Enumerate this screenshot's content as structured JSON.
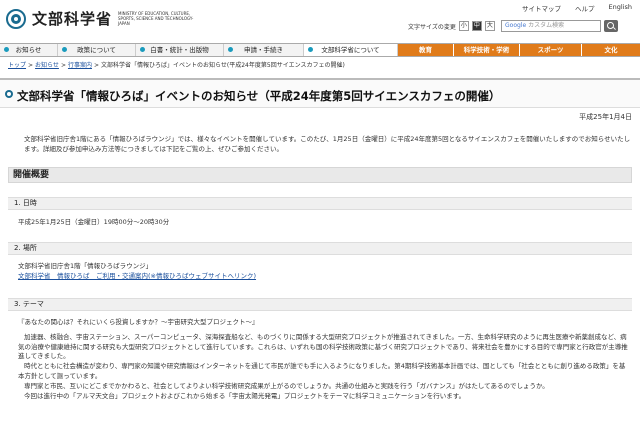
{
  "header": {
    "logo_text": "文部科学省",
    "logo_en": "MINISTRY OF EDUCATION, CULTURE, SPORTS, SCIENCE AND TECHNOLOGY-JAPAN",
    "top_links": [
      "サイトマップ",
      "ヘルプ",
      "English"
    ],
    "fontsize_label": "文字サイズの変更",
    "fontsize_buttons": [
      "小",
      "中",
      "大"
    ],
    "search_brand": "Google",
    "search_placeholder": "カスタム検索"
  },
  "nav": {
    "items": [
      "お知らせ",
      "政策について",
      "白書・統計・出版物",
      "申請・手続き",
      "文部科学省について",
      "教育",
      "科学技術・学術",
      "スポーツ",
      "文化"
    ]
  },
  "breadcrumb": [
    "トップ",
    "お知らせ",
    "行事案内",
    "文部科学省「情報ひろば」イベントのお知らせ(平成24年度第5回サイエンスカフェの開催)"
  ],
  "page": {
    "title": "文部科学省「情報ひろば」イベントのお知らせ（平成24年度第5回サイエンスカフェの開催）",
    "date": "平成25年1月4日",
    "intro": "文部科学省旧庁舎1階にある「情報ひろばラウンジ」では、様々なイベントを開催しています。このたび、1月25日（金曜日）に平成24年度第5回となるサイエンスカフェを開催いたしますのでお知らせいたします。詳細及び参加申込み方法等につきましては下記をご覧の上、ぜひご参加ください。"
  },
  "section": {
    "heading": "開催概要",
    "items": [
      {
        "heading": "1. 日時",
        "text": "平成25年1月25日（金曜日）19時00分～20時30分"
      },
      {
        "heading": "2. 場所",
        "text": "文部科学省旧庁舎1階「情報ひろばラウンジ」",
        "link": "文部科学省　情報ひろば　ご利用・交通案内(※情報ひろばウェブサイトへリンク)"
      },
      {
        "heading": "3. テーマ",
        "subtitle": "『あなたの関心は？それにいくら投資しますか？～宇宙研究大型プロジェクト～』",
        "paragraphs": [
          "加速器、核融合、宇宙ステーション、スーパーコンピュータ、深海探査船など、ものづくりに関係する大型研究プロジェクトが推進されてきました。一方、生命科学研究のように再生医療や新薬創成など、病気の治療や健康維持に関する研究も大型研究プロジェクトとして進行しています。これらは、いずれも国の科学技術政策に基づく研究プロジェクトであり、将来社会を豊かにする目的で専門家と行政官が主導推進してきました。",
          "時代とともに社会構造が変わり、専門家の知識や研究情報はインターネットを通じて市民が誰でも手に入るようになりました。第4期科学技術基本計画では、国としても「社会とともに創り進める政策」を基本方針として謳っています。",
          "専門家と市民、互いにどこまでかかわると、社会としてよりよい科学技術研究成果が上がるのでしょうか。共通の仕組みと実践を行う「ガバナンス」がはたしてあるのでしょうか。",
          "今回は進行中の「アルマ天文台」プロジェクトおよびこれから始まる「宇宙太陽光発電」プロジェクトをテーマに科学コミュニケーションを行います。"
        ]
      }
    ]
  },
  "colors": {
    "accent": "#1a6b8f",
    "nav_orange": "#e07b1a",
    "link": "#1a4f9c"
  }
}
